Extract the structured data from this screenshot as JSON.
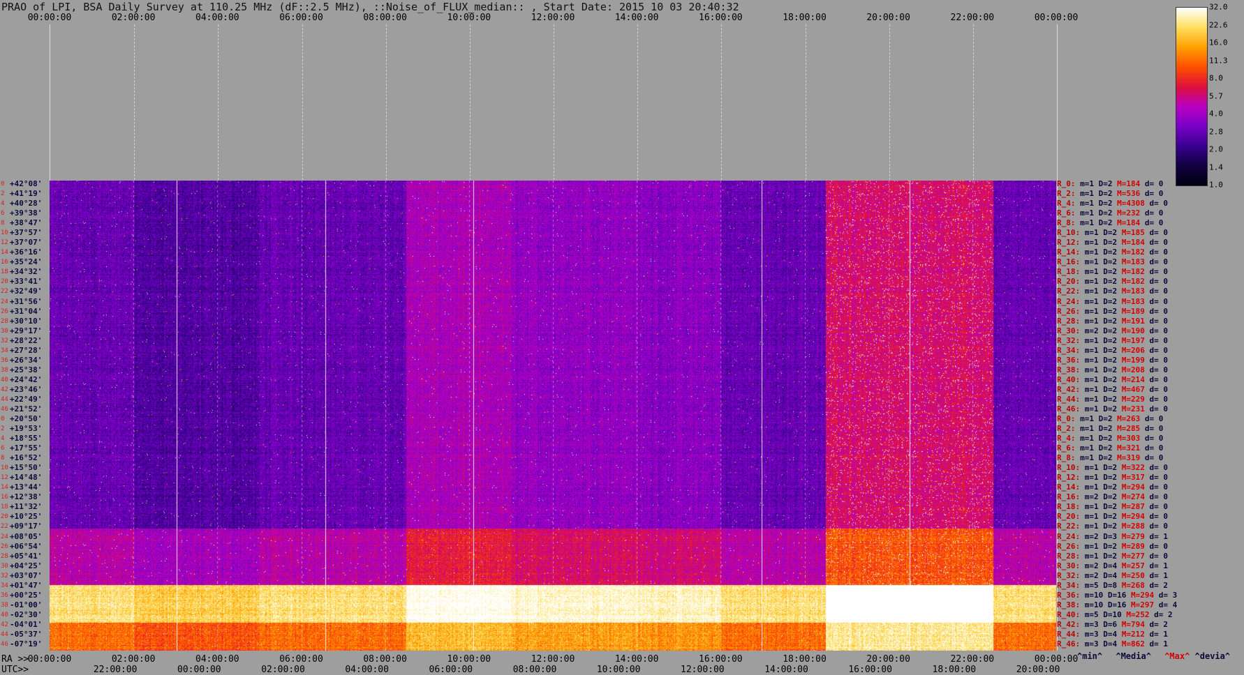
{
  "title": "PRAO of LPI, BSA Daily Survey at 110.25 MHz (dF::2.5 MHz), ::Noise_of_FLUX_median:: , Start Date: 2015 10 03 20:40:32",
  "chart_data": {
    "type": "heatmap",
    "top_axis_ticks": [
      "00:00:00",
      "02:00:00",
      "04:00:00",
      "06:00:00",
      "08:00:00",
      "10:00:00",
      "12:00:00",
      "14:00:00",
      "16:00:00",
      "18:00:00",
      "20:00:00",
      "22:00:00",
      "00:00:00"
    ],
    "ra_axis_label": "RA >>",
    "ra_ticks": [
      "00:00:00",
      "02:00:00",
      "04:00:00",
      "06:00:00",
      "08:00:00",
      "10:00:00",
      "12:00:00",
      "14:00:00",
      "16:00:00",
      "18:00:00",
      "20:00:00",
      "22:00:00",
      "00:00:00"
    ],
    "utc_axis_label": "UTC>>",
    "utc_ticks": [
      "22:00:00",
      "00:00:00",
      "02:00:00",
      "04:00:00",
      "06:00:00",
      "08:00:00",
      "10:00:00",
      "12:00:00",
      "14:00:00",
      "16:00:00",
      "18:00:00",
      "20:00:00"
    ],
    "colorbar_ticks": [
      "32.0",
      "22.6",
      "16.0",
      "11.3",
      "8.0",
      "5.7",
      "4.0",
      "2.8",
      "2.0",
      "1.4",
      "1.0"
    ],
    "colorbar_scale": "log",
    "colorbar_range": [
      1.0,
      32.0
    ],
    "colormap": [
      "#000010",
      "#120040",
      "#3a0090",
      "#7a00c8",
      "#b800c0",
      "#e0103a",
      "#ff5000",
      "#ffa000",
      "#ffe060",
      "#ffffff"
    ],
    "declinations": [
      "+42°08'",
      "+41°19'",
      "+40°28'",
      "+39°38'",
      "+38°47'",
      "+37°57'",
      "+37°07'",
      "+36°16'",
      "+35°24'",
      "+34°32'",
      "+33°41'",
      "+32°49'",
      "+31°56'",
      "+31°04'",
      "+30°10'",
      "+29°17'",
      "+28°22'",
      "+27°28'",
      "+26°34'",
      "+25°38'",
      "+24°42'",
      "+23°46'",
      "+22°49'",
      "+21°52'",
      "+20°50'",
      "+19°53'",
      "+18°55'",
      "+17°55'",
      "+16°52'",
      "+15°50'",
      "+14°48'",
      "+13°44'",
      "+12°38'",
      "+11°32'",
      "+10°25'",
      "+09°17'",
      "+08°05'",
      "+06°54'",
      "+05°41'",
      "+04°25'",
      "+03°07'",
      "+01°47'",
      "+00°25'",
      "-01°00'",
      "-02°30'",
      "-04°01'",
      "-05°37'",
      "-07°19'"
    ],
    "declination_indices": [
      "0",
      "2",
      "4",
      "6",
      "8",
      "10",
      "12",
      "14",
      "16",
      "18",
      "20",
      "22",
      "24",
      "26",
      "28",
      "30",
      "32",
      "34",
      "36",
      "38",
      "40",
      "42",
      "44",
      "46",
      "0",
      "2",
      "4",
      "6",
      "8",
      "10",
      "12",
      "14",
      "16",
      "18",
      "20",
      "22",
      "24",
      "26",
      "28",
      "30",
      "32",
      "34",
      "36",
      "38",
      "40",
      "42",
      "44",
      "46"
    ],
    "row_stats": [
      {
        "r": "R_0:",
        "m": "m=1",
        "d": "D=2",
        "x": "M=184",
        "dv": "d= 0"
      },
      {
        "r": "R_2:",
        "m": "m=1",
        "d": "D=2",
        "x": "M=536",
        "dv": "d= 0"
      },
      {
        "r": "R_4:",
        "m": "m=1",
        "d": "D=2",
        "x": "M=4308",
        "dv": "d= 0"
      },
      {
        "r": "R_6:",
        "m": "m=1",
        "d": "D=2",
        "x": "M=232",
        "dv": "d= 0"
      },
      {
        "r": "R_8:",
        "m": "m=1",
        "d": "D=2",
        "x": "M=184",
        "dv": "d= 0"
      },
      {
        "r": "R_10:",
        "m": "m=1",
        "d": "D=2",
        "x": "M=185",
        "dv": "d= 0"
      },
      {
        "r": "R_12:",
        "m": "m=1",
        "d": "D=2",
        "x": "M=184",
        "dv": "d= 0"
      },
      {
        "r": "R_14:",
        "m": "m=1",
        "d": "D=2",
        "x": "M=182",
        "dv": "d= 0"
      },
      {
        "r": "R_16:",
        "m": "m=1",
        "d": "D=2",
        "x": "M=183",
        "dv": "d= 0"
      },
      {
        "r": "R_18:",
        "m": "m=1",
        "d": "D=2",
        "x": "M=182",
        "dv": "d= 0"
      },
      {
        "r": "R_20:",
        "m": "m=1",
        "d": "D=2",
        "x": "M=182",
        "dv": "d= 0"
      },
      {
        "r": "R_22:",
        "m": "m=1",
        "d": "D=2",
        "x": "M=183",
        "dv": "d= 0"
      },
      {
        "r": "R_24:",
        "m": "m=1",
        "d": "D=2",
        "x": "M=183",
        "dv": "d= 0"
      },
      {
        "r": "R_26:",
        "m": "m=1",
        "d": "D=2",
        "x": "M=189",
        "dv": "d= 0"
      },
      {
        "r": "R_28:",
        "m": "m=1",
        "d": "D=2",
        "x": "M=191",
        "dv": "d= 0"
      },
      {
        "r": "R_30:",
        "m": "m=2",
        "d": "D=2",
        "x": "M=190",
        "dv": "d= 0"
      },
      {
        "r": "R_32:",
        "m": "m=1",
        "d": "D=2",
        "x": "M=197",
        "dv": "d= 0"
      },
      {
        "r": "R_34:",
        "m": "m=1",
        "d": "D=2",
        "x": "M=206",
        "dv": "d= 0"
      },
      {
        "r": "R_36:",
        "m": "m=1",
        "d": "D=2",
        "x": "M=199",
        "dv": "d= 0"
      },
      {
        "r": "R_38:",
        "m": "m=1",
        "d": "D=2",
        "x": "M=208",
        "dv": "d= 0"
      },
      {
        "r": "R_40:",
        "m": "m=1",
        "d": "D=2",
        "x": "M=214",
        "dv": "d= 0"
      },
      {
        "r": "R_42:",
        "m": "m=1",
        "d": "D=2",
        "x": "M=467",
        "dv": "d= 0"
      },
      {
        "r": "R_44:",
        "m": "m=1",
        "d": "D=2",
        "x": "M=229",
        "dv": "d= 0"
      },
      {
        "r": "R_46:",
        "m": "m=1",
        "d": "D=2",
        "x": "M=231",
        "dv": "d= 0"
      },
      {
        "r": "R_0:",
        "m": "m=1",
        "d": "D=2",
        "x": "M=263",
        "dv": "d= 0"
      },
      {
        "r": "R_2:",
        "m": "m=1",
        "d": "D=2",
        "x": "M=285",
        "dv": "d= 0"
      },
      {
        "r": "R_4:",
        "m": "m=1",
        "d": "D=2",
        "x": "M=303",
        "dv": "d= 0"
      },
      {
        "r": "R_6:",
        "m": "m=1",
        "d": "D=2",
        "x": "M=321",
        "dv": "d= 0"
      },
      {
        "r": "R_8:",
        "m": "m=1",
        "d": "D=2",
        "x": "M=319",
        "dv": "d= 0"
      },
      {
        "r": "R_10:",
        "m": "m=1",
        "d": "D=2",
        "x": "M=322",
        "dv": "d= 0"
      },
      {
        "r": "R_12:",
        "m": "m=1",
        "d": "D=2",
        "x": "M=317",
        "dv": "d= 0"
      },
      {
        "r": "R_14:",
        "m": "m=1",
        "d": "D=2",
        "x": "M=294",
        "dv": "d= 0"
      },
      {
        "r": "R_16:",
        "m": "m=2",
        "d": "D=2",
        "x": "M=274",
        "dv": "d= 0"
      },
      {
        "r": "R_18:",
        "m": "m=1",
        "d": "D=2",
        "x": "M=287",
        "dv": "d= 0"
      },
      {
        "r": "R_20:",
        "m": "m=1",
        "d": "D=2",
        "x": "M=294",
        "dv": "d= 0"
      },
      {
        "r": "R_22:",
        "m": "m=1",
        "d": "D=2",
        "x": "M=288",
        "dv": "d= 0"
      },
      {
        "r": "R_24:",
        "m": "m=2",
        "d": "D=3",
        "x": "M=279",
        "dv": "d= 1"
      },
      {
        "r": "R_26:",
        "m": "m=1",
        "d": "D=2",
        "x": "M=289",
        "dv": "d= 0"
      },
      {
        "r": "R_28:",
        "m": "m=1",
        "d": "D=2",
        "x": "M=277",
        "dv": "d= 0"
      },
      {
        "r": "R_30:",
        "m": "m=2",
        "d": "D=4",
        "x": "M=257",
        "dv": "d= 1"
      },
      {
        "r": "R_32:",
        "m": "m=2",
        "d": "D=4",
        "x": "M=250",
        "dv": "d= 1"
      },
      {
        "r": "R_34:",
        "m": "m=5",
        "d": "D=8",
        "x": "M=268",
        "dv": "d= 2"
      },
      {
        "r": "R_36:",
        "m": "m=10",
        "d": "D=16",
        "x": "M=294",
        "dv": "d= 3"
      },
      {
        "r": "R_38:",
        "m": "m=10",
        "d": "D=16",
        "x": "M=297",
        "dv": "d= 4"
      },
      {
        "r": "R_40:",
        "m": "m=5",
        "d": "D=10",
        "x": "M=252",
        "dv": "d= 2"
      },
      {
        "r": "R_42:",
        "m": "m=3",
        "d": "D=6",
        "x": "M=794",
        "dv": "d= 2"
      },
      {
        "r": "R_44:",
        "m": "m=3",
        "d": "D=4",
        "x": "M=212",
        "dv": "d= 1"
      },
      {
        "r": "R_46:",
        "m": "m=3",
        "d": "D=4",
        "x": "M=862",
        "dv": "d= 1"
      }
    ]
  },
  "legend": {
    "min": "^min^",
    "media": "^Media^",
    "max": "^Max^",
    "devia": "^devia^"
  },
  "colors": {
    "background": "#9e9e9e",
    "index_red": "#d42020",
    "max_red": "#d40000",
    "dark_text": "#0a0a3a"
  }
}
